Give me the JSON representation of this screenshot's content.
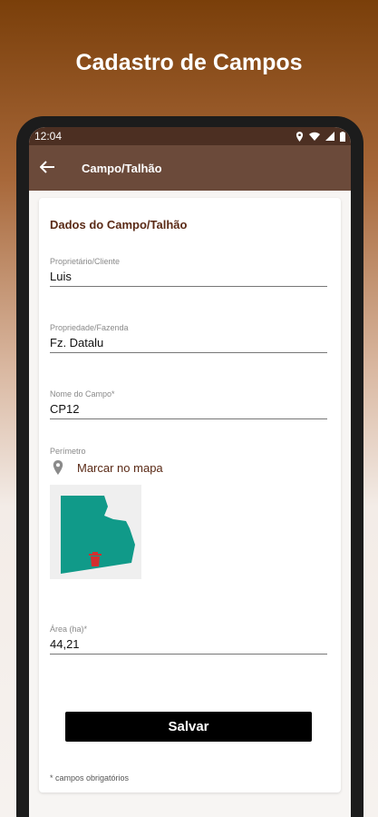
{
  "promo": {
    "title": "Cadastro de Campos"
  },
  "status_bar": {
    "time": "12:04"
  },
  "app_bar": {
    "title": "Campo/Talhão"
  },
  "form": {
    "section_title": "Dados do Campo/Talhão",
    "owner": {
      "label": "Proprietário/Cliente",
      "value": "Luis"
    },
    "property": {
      "label": "Propriedade/Fazenda",
      "value": "Fz. Datalu"
    },
    "field_name": {
      "label": "Nome do Campo*",
      "value": "CP12"
    },
    "perimeter": {
      "label": "Perímetro",
      "map_link": "Marcar no mapa"
    },
    "area": {
      "label": "Área (ha)*",
      "value": "44,21"
    },
    "save_label": "Salvar",
    "required_note": "* campos obrigatórios"
  },
  "colors": {
    "app_bar": "#6b4a3a",
    "status_bar": "#4c2f22",
    "accent_text": "#5a2a16",
    "polygon": "#109a89",
    "trash": "#d32f2f"
  }
}
